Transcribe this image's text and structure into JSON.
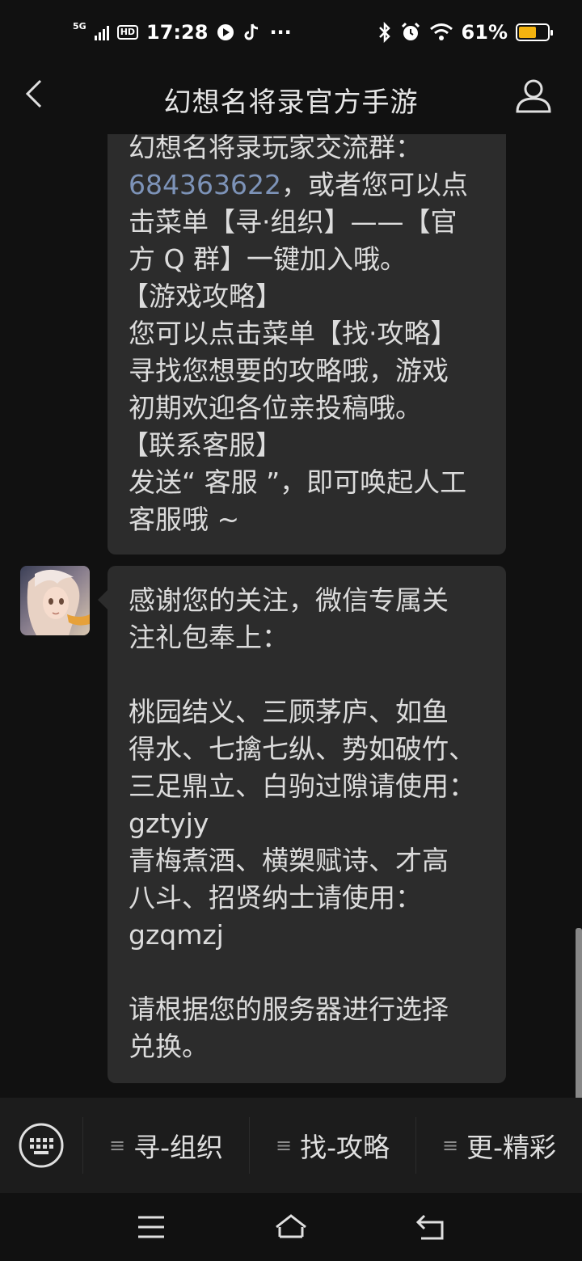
{
  "status_bar": {
    "network": "5G",
    "hd": "HD",
    "time": "17:28",
    "more": "···",
    "battery_percent": "61%",
    "battery_level": 0.61,
    "battery_color": "#f3b30f"
  },
  "header": {
    "title": "幻想名将录官方手游"
  },
  "messages": [
    {
      "lines": [
        "幻想名将录玩家交流群：",
        "684363622",
        "，或者您可以点",
        "击菜单【寻·组织】——【官",
        "方 Q 群】一键加入哦。",
        "【游戏攻略】",
        "您可以点击菜单【找·攻略】",
        "寻找您想要的攻略哦，游戏",
        "初期欢迎各位亲投稿哦。",
        "【联系客服】",
        "发送“ 客服 ”，即可唤起人工",
        "客服哦 ~"
      ],
      "link_color": "#7d93b8"
    },
    {
      "lines": [
        "感谢您的关注，微信专属关",
        "注礼包奉上：",
        "桃园结义、三顾茅庐、如鱼",
        "得水、七擒七纵、势如破竹、",
        "三足鼎立、白驹过隙请使用：",
        "gztyjy",
        "青梅煮酒、横槊赋诗、才高",
        "八斗、招贤纳士请使用：",
        "gzqmzj",
        "请根据您的服务器进行选择",
        "兑换。"
      ]
    }
  ],
  "menu": {
    "items": [
      {
        "label": "寻-组织"
      },
      {
        "label": "找-攻略"
      },
      {
        "label": "更-精彩"
      }
    ],
    "list_icon": "≡"
  },
  "colors": {
    "background": "#111111",
    "bubble": "#2c2c2c",
    "menu_bar": "#1c1c1c"
  }
}
